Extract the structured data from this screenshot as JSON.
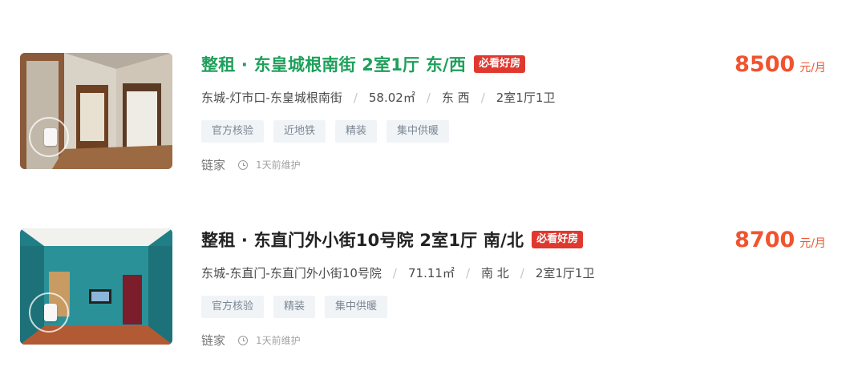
{
  "listings": [
    {
      "title": "整租 · 东皇城根南街 2室1厅 东/西",
      "badge": "必看好房",
      "price": "8500",
      "price_unit": "元/月",
      "location": "东城-灯市口-东皇城根南街",
      "area": "58.02㎡",
      "orientation": "东 西",
      "layout": "2室1厅1卫",
      "tags": [
        "官方核验",
        "近地铁",
        "精装",
        "集中供暖"
      ],
      "agency": "链家",
      "updated": "1天前维护",
      "thumbnail_icon": "vr-tour-icon"
    },
    {
      "title": "整租 · 东直门外小街10号院 2室1厅 南/北",
      "badge": "必看好房",
      "price": "8700",
      "price_unit": "元/月",
      "location": "东城-东直门-东直门外小街10号院",
      "area": "71.11㎡",
      "orientation": "南 北",
      "layout": "2室1厅1卫",
      "tags": [
        "官方核验",
        "精装",
        "集中供暖"
      ],
      "agency": "链家",
      "updated": "1天前维护",
      "thumbnail_icon": "vr-tour-icon"
    }
  ],
  "colors": {
    "title_highlight": "#1ea05b",
    "title_default": "#222222",
    "price": "#f0532e",
    "badge_bg": "#e0382e",
    "tag_bg": "#f1f4f7",
    "tag_text": "#7b8794"
  }
}
